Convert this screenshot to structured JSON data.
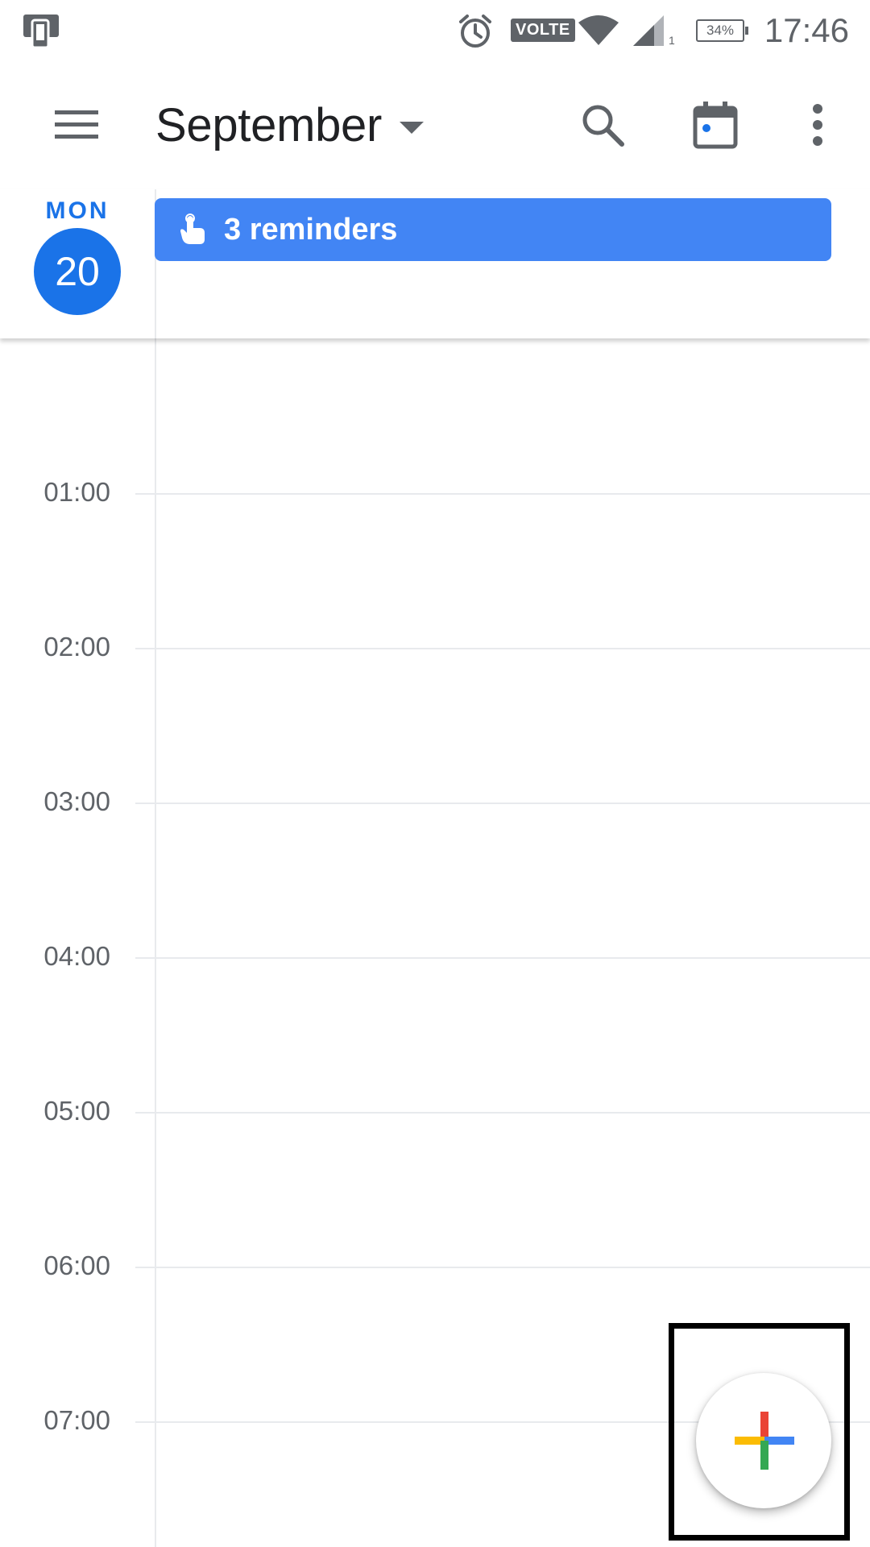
{
  "status_bar": {
    "network_badge": "VOLTE",
    "signal_sub": "1",
    "battery_percent": "34%",
    "time": "17:46",
    "icons": [
      "device-icon",
      "alarm-icon",
      "wifi-icon",
      "signal-icon",
      "battery-icon"
    ]
  },
  "app_bar": {
    "month": "September",
    "icons": [
      "menu-icon",
      "dropdown-caret-icon",
      "search-icon",
      "today-calendar-icon",
      "more-vert-icon"
    ]
  },
  "day": {
    "weekday": "MON",
    "date": "20"
  },
  "reminders": {
    "label": "3 reminders",
    "icon": "reminder-hand-icon"
  },
  "timeline": {
    "hours": [
      "01:00",
      "02:00",
      "03:00",
      "04:00",
      "05:00",
      "06:00",
      "07:00"
    ]
  },
  "fab": {
    "icon": "plus-icon"
  },
  "colors": {
    "accent_blue": "#1a73e8",
    "chip_blue": "#4285f4",
    "plus_red": "#ea4335",
    "plus_yellow": "#fbbc04",
    "plus_green": "#34a853",
    "plus_blue": "#4285f4"
  }
}
